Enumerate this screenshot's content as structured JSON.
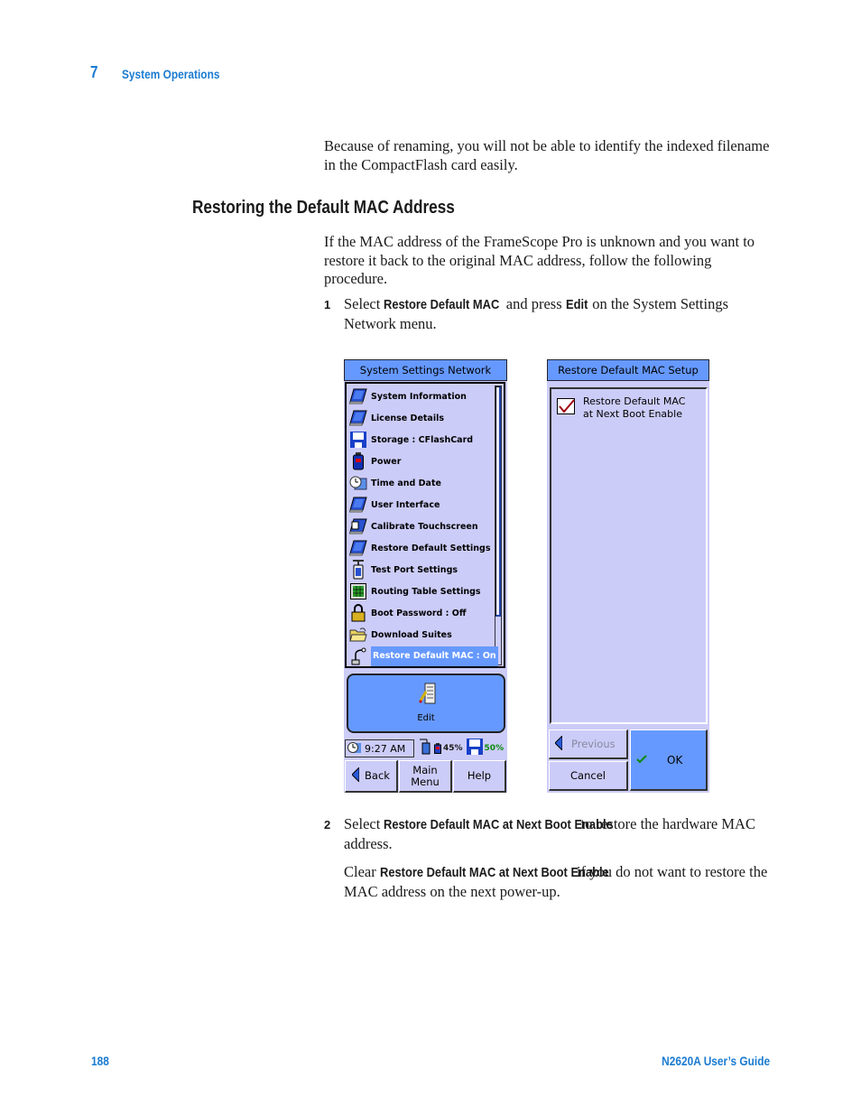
{
  "header": {
    "chapter_number": "7",
    "chapter_title": "System Operations"
  },
  "body": {
    "intro_paragraph": "Because of renaming, you will not be able to identify the indexed filename in the CompactFlash card easily.",
    "section_heading": "Restoring the Default MAC Address",
    "section_paragraph": "If the MAC address of the FrameScope Pro is unknown and you want to restore it back to the original MAC address, follow the following procedure.",
    "steps": [
      {
        "number": "1",
        "pre": "Select ",
        "bold1": "Restore Default MAC",
        "mid": " and press ",
        "bold2": "Edit",
        "post": " on the System Settings Network menu."
      },
      {
        "number": "2",
        "pre": "Select ",
        "bold1": "Restore Default MAC at Next Boot Enable",
        "post": " to restore the hardware MAC address."
      }
    ],
    "clear_note": {
      "pre": "Clear ",
      "bold": "Restore Default MAC at Next Boot Enable",
      "post": " if you do not want to restore the MAC address on the next power-up."
    }
  },
  "screen_left": {
    "title": "System Settings Network",
    "items": [
      {
        "label": "System Information",
        "icon": "pda-icon"
      },
      {
        "label": "License Details",
        "icon": "pda-icon"
      },
      {
        "label": "Storage : CFlashCard",
        "icon": "compactflash-disk-icon"
      },
      {
        "label": "Power",
        "icon": "battery-icon"
      },
      {
        "label": "Time and Date",
        "icon": "clock-calendar-icon"
      },
      {
        "label": "User Interface",
        "icon": "pda-icon"
      },
      {
        "label": "Calibrate Touchscreen",
        "icon": "touchscreen-calibrate-icon"
      },
      {
        "label": "Restore Default Settings",
        "icon": "pda-icon"
      },
      {
        "label": "Test Port Settings",
        "icon": "test-port-icon"
      },
      {
        "label": "Routing Table Settings",
        "icon": "routing-table-icon"
      },
      {
        "label": "Boot Password : Off",
        "icon": "padlock-icon"
      },
      {
        "label": "Download Suites",
        "icon": "folder-download-icon"
      },
      {
        "label": "Restore Default MAC : On",
        "icon": "network-cable-icon",
        "selected": true
      }
    ],
    "edit_button": "Edit",
    "status": {
      "time": "9:27 AM",
      "battery_percent": "45%",
      "cf_percent": "50%"
    },
    "nav": {
      "back": "Back",
      "main_menu": "Main Menu",
      "help": "Help"
    }
  },
  "screen_right": {
    "title": "Restore Default MAC Setup",
    "checkbox_label_line1": "Restore Default MAC",
    "checkbox_label_line2": "at Next Boot Enable",
    "checkbox_checked": true,
    "previous_button": "Previous",
    "cancel_button": "Cancel",
    "ok_button": "OK"
  },
  "footer": {
    "page_number": "188",
    "guide_title": "N2620A User’s Guide"
  }
}
